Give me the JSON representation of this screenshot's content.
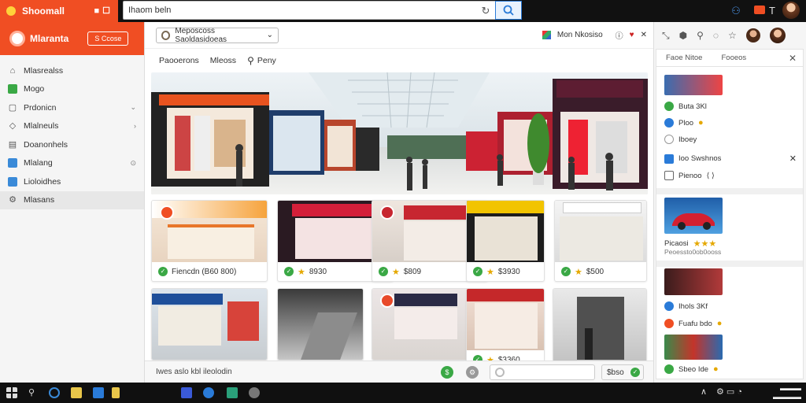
{
  "titlebar": {
    "app_name": "Shoomall",
    "search_value": "Ihaom beln",
    "icons": [
      "refresh-icon",
      "search-icon",
      "person-icon",
      "notification-icon",
      "user-avatar"
    ]
  },
  "sidebar": {
    "brand": "Mlaranta",
    "badge": "S Ccose",
    "items": [
      {
        "label": "Mlasrealss",
        "icon": "home-icon"
      },
      {
        "label": "Mogo",
        "icon": "store-icon"
      },
      {
        "label": "Prdonicn",
        "icon": "bag-icon"
      },
      {
        "label": "Mlalneuls",
        "icon": "tag-icon"
      },
      {
        "label": "Doanonhels",
        "icon": "calendar-icon"
      },
      {
        "label": "Mlalang",
        "icon": "chat-icon"
      },
      {
        "label": "Lioloidhes",
        "icon": "map-icon"
      },
      {
        "label": "Mlasans",
        "icon": "settings-icon"
      }
    ]
  },
  "main": {
    "location": "Meposcoss Saoldasidoeas",
    "toolbar_right": "Mon Nkosiso",
    "tabs": [
      "Paooerons",
      "Mleoss",
      "Peny"
    ],
    "cards": [
      {
        "price": "Fiencdn (B60 800)"
      },
      {
        "price": "8930"
      },
      {
        "price": "$809"
      },
      {
        "price": "$3930"
      },
      {
        "price": "$500"
      },
      {
        "price": "$3360"
      }
    ],
    "status_text": "Iwes aslo kbl ileolodin",
    "bottom_action": "$bso"
  },
  "rightpanel": {
    "tabs": [
      "Faoe Nitoe",
      "Fooeos"
    ],
    "items": [
      {
        "label": "Buta 3Kl"
      },
      {
        "label": "Ploo"
      },
      {
        "label": "Iboey"
      },
      {
        "label": "Ioo Swshnos"
      },
      {
        "label": "Pienoo"
      },
      {
        "label": "Picaosi"
      },
      {
        "label": "Peoessto0ob0ooss"
      },
      {
        "label": "Ihols 3Kf"
      },
      {
        "label": "Fuafu bdo"
      },
      {
        "label": "Sbeo Ide"
      }
    ]
  },
  "colors": {
    "accent": "#f04e23",
    "success": "#3aa845",
    "link": "#2a7bd8"
  }
}
